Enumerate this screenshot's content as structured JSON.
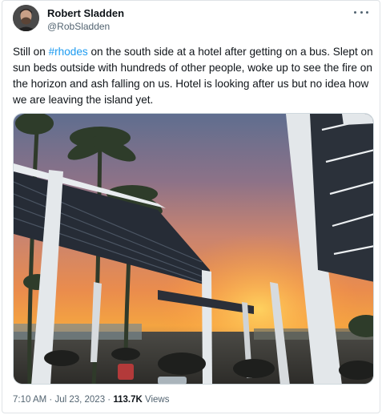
{
  "author": {
    "display_name": "Robert Sladden",
    "handle": "@RobSladden",
    "avatar_icon": "profile-photo"
  },
  "more_icon": "more-options-icon",
  "post": {
    "text_before": "Still on ",
    "hashtag": "#rhodes",
    "text_after": " on the south side at a hotel after getting on a bus. Slept on sun beds outside with hundreds of other people, woke up to see the fire on the horizon and ash falling on us. Hotel is looking after us but no idea how we are leaving the island yet."
  },
  "media": {
    "type": "photo",
    "subject": "sunset-sky-over-hotel-pergolas"
  },
  "meta": {
    "time": "7:10 AM",
    "sep1": " · ",
    "date": "Jul 23, 2023",
    "sep2": " · ",
    "views_count": "113.7K",
    "views_label": " Views"
  },
  "colors": {
    "link": "#1d9bf0",
    "secondary_text": "#536471",
    "primary_text": "#0f1419"
  }
}
